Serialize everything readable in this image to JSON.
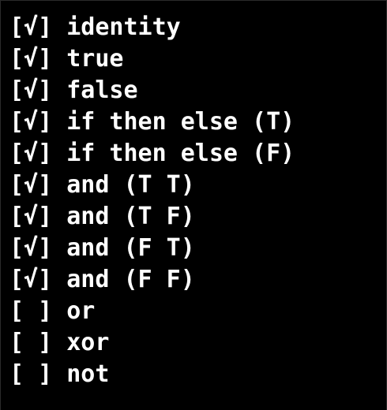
{
  "terminal": {
    "separator": " ",
    "lines": [
      {
        "status": "[√]",
        "name": "identity"
      },
      {
        "status": "[√]",
        "name": "true"
      },
      {
        "status": "[√]",
        "name": "false"
      },
      {
        "status": "[√]",
        "name": "if then else (T)"
      },
      {
        "status": "[√]",
        "name": "if then else (F)"
      },
      {
        "status": "[√]",
        "name": "and (T T)"
      },
      {
        "status": "[√]",
        "name": "and (T F)"
      },
      {
        "status": "[√]",
        "name": "and (F T)"
      },
      {
        "status": "[√]",
        "name": "and (F F)"
      },
      {
        "status": "[ ]",
        "name": "or"
      },
      {
        "status": "[ ]",
        "name": "xor"
      },
      {
        "status": "[ ]",
        "name": "not"
      }
    ]
  }
}
